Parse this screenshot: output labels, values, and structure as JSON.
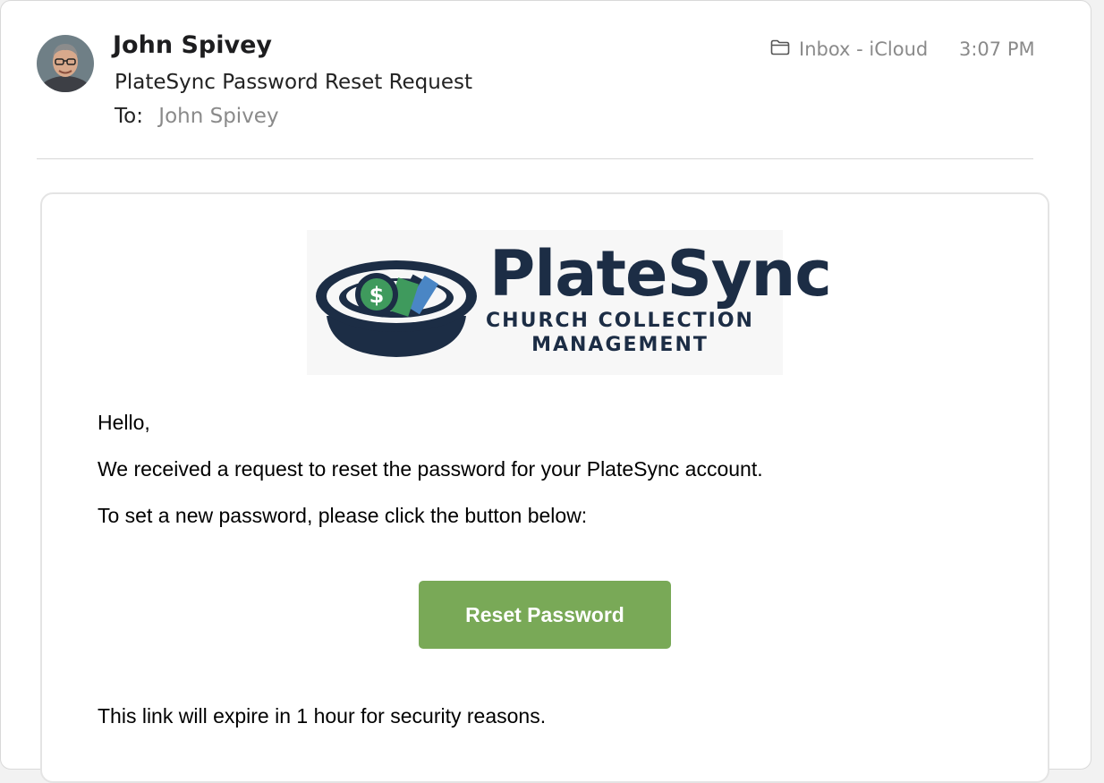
{
  "header": {
    "sender": "John Spivey",
    "subject": "PlateSync Password Reset Request",
    "to_label": "To:",
    "to_value": "John Spivey",
    "mailbox": "Inbox - iCloud",
    "time": "3:07 PM"
  },
  "logo": {
    "title": "PlateSync",
    "subtitle_line1": "CHURCH COLLECTION",
    "subtitle_line2": "MANAGEMENT",
    "coin_symbol": "$"
  },
  "message": {
    "greeting": "Hello,",
    "line1": "We received a request to reset the password for your PlateSync account.",
    "line2": "To set a new password, please click the button below:",
    "button_label": "Reset Password",
    "expiry": "This link will expire in 1 hour for security reasons."
  },
  "colors": {
    "button": "#79a957",
    "brand_navy": "#1c2d45",
    "brand_green": "#3f9a5d"
  },
  "icons": {
    "mailbox": "folder-icon"
  }
}
